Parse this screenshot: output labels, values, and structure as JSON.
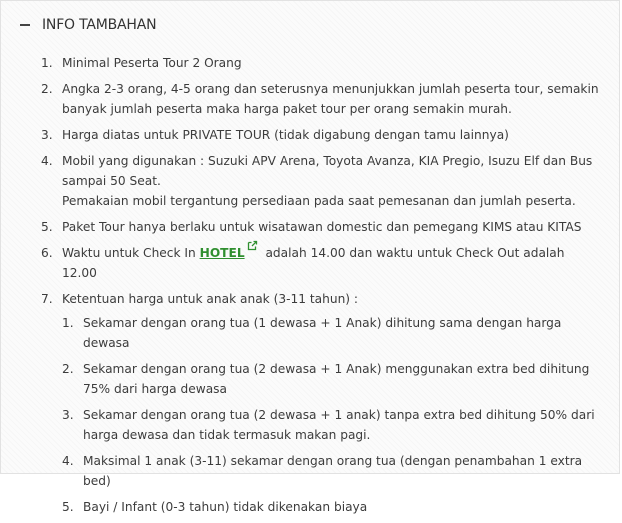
{
  "section": {
    "toggle_symbol": "−",
    "title": "INFO TAMBAHAN"
  },
  "items": [
    {
      "num": "1.",
      "text": "Minimal Peserta Tour 2 Orang"
    },
    {
      "num": "2.",
      "text": "Angka 2-3 orang, 4-5 orang dan seterusnya menunjukkan jumlah peserta tour, semakin banyak jumlah peserta maka harga paket tour per orang semakin murah."
    },
    {
      "num": "3.",
      "text": "Harga diatas untuk PRIVATE TOUR (tidak digabung dengan tamu lainnya)"
    },
    {
      "num": "4.",
      "line1": "Mobil yang digunakan : Suzuki APV Arena, Toyota Avanza, KIA Pregio, Isuzu Elf dan Bus sampai 50 Seat.",
      "line2": "Pemakaian mobil tergantung persediaan pada saat pemesanan dan jumlah peserta."
    },
    {
      "num": "5.",
      "text": "Paket Tour hanya berlaku untuk wisatawan domestic dan pemegang KIMS atau KITAS"
    },
    {
      "num": "6.",
      "before": "Waktu untuk Check In",
      "link": "HOTEL",
      "after": "adalah 14.00 dan waktu untuk Check Out adalah 12.00"
    },
    {
      "num": "7.",
      "text": "Ketentuan harga untuk anak anak (3-11 tahun) :",
      "sub": [
        {
          "num": "1.",
          "text": "Sekamar dengan orang tua (1 dewasa + 1 Anak) dihitung sama dengan harga dewasa"
        },
        {
          "num": "2.",
          "text": "Sekamar dengan orang tua (2 dewasa + 1 Anak) menggunakan extra bed dihitung 75% dari harga dewasa"
        },
        {
          "num": "3.",
          "text": "Sekamar dengan orang tua (2 dewasa + 1 anak) tanpa extra bed dihitung 50% dari harga dewasa dan tidak termasuk makan pagi."
        },
        {
          "num": "4.",
          "text": "Maksimal 1 anak (3-11) sekamar dengan orang tua (dengan penambahan 1 extra bed)"
        },
        {
          "num": "5.",
          "text": "Bayi / Infant (0-3 tahun) tidak dikenakan biaya"
        }
      ]
    }
  ],
  "colors": {
    "link": "#2f8f2f",
    "text": "#3c3c3c",
    "border": "#e2e2e2"
  },
  "icons": {
    "external_link": "external-link-icon"
  }
}
